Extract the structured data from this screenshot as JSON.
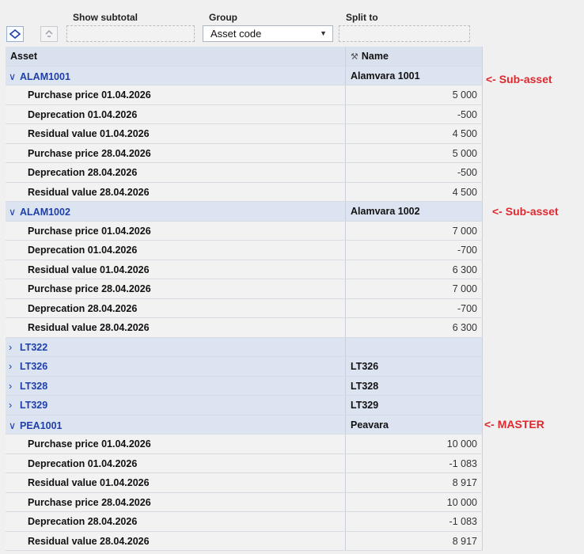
{
  "toolbar": {
    "show_subtotal_label": "Show subtotal",
    "group_label": "Group",
    "group_value": "Asset code",
    "split_to_label": "Split to"
  },
  "grid": {
    "columns": {
      "asset": "Asset",
      "name": "Name"
    },
    "groups": [
      {
        "code": "ALAM1001",
        "name": "Alamvara 1001",
        "expanded": true,
        "rows": [
          {
            "label": "Purchase price 01.04.2026",
            "value": "5 000"
          },
          {
            "label": "Deprecation 01.04.2026",
            "value": "-500"
          },
          {
            "label": "Residual value 01.04.2026",
            "value": "4 500"
          },
          {
            "label": "Purchase price 28.04.2026",
            "value": "5 000"
          },
          {
            "label": "Deprecation 28.04.2026",
            "value": "-500"
          },
          {
            "label": "Residual value 28.04.2026",
            "value": "4 500"
          }
        ]
      },
      {
        "code": "ALAM1002",
        "name": "Alamvara 1002",
        "expanded": true,
        "rows": [
          {
            "label": "Purchase price 01.04.2026",
            "value": "7 000"
          },
          {
            "label": "Deprecation 01.04.2026",
            "value": "-700"
          },
          {
            "label": "Residual value 01.04.2026",
            "value": "6 300"
          },
          {
            "label": "Purchase price 28.04.2026",
            "value": "7 000"
          },
          {
            "label": "Deprecation 28.04.2026",
            "value": "-700"
          },
          {
            "label": "Residual value 28.04.2026",
            "value": "6 300"
          }
        ]
      },
      {
        "code": "LT322",
        "name": "",
        "expanded": false,
        "rows": []
      },
      {
        "code": "LT326",
        "name": "LT326",
        "expanded": false,
        "rows": []
      },
      {
        "code": "LT328",
        "name": "LT328",
        "expanded": false,
        "rows": []
      },
      {
        "code": "LT329",
        "name": "LT329",
        "expanded": false,
        "rows": []
      },
      {
        "code": "PEA1001",
        "name": "Peavara",
        "expanded": true,
        "rows": [
          {
            "label": "Purchase price 01.04.2026",
            "value": "10 000"
          },
          {
            "label": "Deprecation 01.04.2026",
            "value": "-1 083"
          },
          {
            "label": "Residual value 01.04.2026",
            "value": "8 917"
          },
          {
            "label": "Purchase price 28.04.2026",
            "value": "10 000"
          },
          {
            "label": "Deprecation 28.04.2026",
            "value": "-1 083"
          },
          {
            "label": "Residual value 28.04.2026",
            "value": "8 917"
          }
        ]
      }
    ]
  },
  "annotations": {
    "note_1": "<- Sub-asset",
    "note_2": "<- Sub-asset",
    "note_3": "<- MASTER"
  },
  "colors": {
    "accent": "#1f3fa8",
    "annotation": "#e0282f",
    "header": "#d9e1ee"
  }
}
